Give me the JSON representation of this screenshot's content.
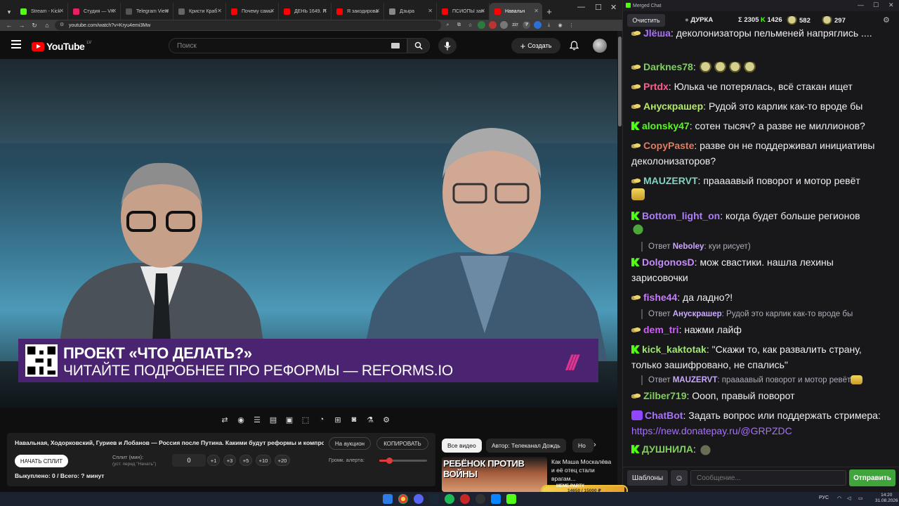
{
  "browser": {
    "tabs": [
      {
        "label": "Stream - Kick",
        "color": "#53fc18"
      },
      {
        "label": "Студия — VK",
        "color": "#e91e63"
      },
      {
        "label": "Telegram View",
        "color": "#555555"
      },
      {
        "label": "Кристи Краб",
        "color": "#666666"
      },
      {
        "label": "Почему самы",
        "color": "#ff0000"
      },
      {
        "label": "ДЕНЬ 1649. П",
        "color": "#ff0000"
      },
      {
        "label": "Я закодирова",
        "color": "#ff0000"
      },
      {
        "label": "Дзыра",
        "color": "#888888"
      },
      {
        "label": "ПСИОПЫ зап",
        "color": "#ff0000"
      },
      {
        "label": "Навальн",
        "color": "#ff0000",
        "active": true
      }
    ],
    "url": "youtube.com/watch?v=Kryu4emi3Mw",
    "ext_badge": "237"
  },
  "youtube": {
    "logo": "YouTube",
    "country": "LV",
    "search_placeholder": "Поиск",
    "create_label": "Создать"
  },
  "video": {
    "banner_line1": "ПРОЕКТ «ЧТО ДЕЛАТЬ?»",
    "banner_line2": "ЧИТАЙТЕ ПОДРОБНЕЕ ПРО РЕФОРМЫ — REFORMS.IO",
    "banner_mark": "///"
  },
  "info": {
    "title": "Навальная, Ходорковский, Гуриев и Лобанов — Россия после Путина. Какими будут реформы и компро...",
    "auction_label": "На аукцион",
    "copy_label": "КОПИРОВАТЬ",
    "split_button": "НАЧАТЬ СПЛИТ",
    "split_label": "Сплит (мин):",
    "split_hint": "(уст. перед \"Начать\")",
    "split_value": "0",
    "steps": [
      "+1",
      "+3",
      "+5",
      "+10",
      "+20"
    ],
    "alert_label": "Громк. алерта:",
    "alert_volume": 0.2,
    "bought": "Выкуплено: 0 / Всего: ? минут"
  },
  "recs": {
    "chips": [
      "Все видео",
      "Автор: Телеканал Дождь",
      "Но"
    ],
    "thumb_text": "РЕБЁНОК ПРОТИВ ВОЙНЫ",
    "rec_title": "Как Маша Москалёва и её отец стали врагам..."
  },
  "stream_goal": {
    "label": "МЕМЕ-PARTY",
    "text": "14650 / 15000 ₽",
    "progress": 0.976
  },
  "taskbar": {
    "lang": "РУС",
    "time": "14:20",
    "date": "31.08.2026"
  },
  "chat": {
    "window_title": "Merged Chat",
    "clear_label": "Очистить",
    "stats": {
      "status": "ДУРКА",
      "sigma": "Σ 2305",
      "kick": "1426",
      "other": "582",
      "viewers": "297"
    },
    "messages": [
      {
        "badge": "sub",
        "nick": "Jlёша",
        "color": "#a970ff",
        "text": "деколонизаторы пельменей напряглись ...."
      },
      {
        "badge": "sub",
        "nick": "Darknes78",
        "color": "#7fcf5c",
        "text": "",
        "emotes": [
          "ape",
          "ape",
          "ape",
          "ape"
        ]
      },
      {
        "badge": "sub",
        "nick": "Prtdx",
        "color": "#ff5d8f",
        "text": "Юлька че потерялась, всё стакан ищет"
      },
      {
        "badge": "sub",
        "nick": "Анускрашер",
        "color": "#b3e86a",
        "text": "Рудой это карлик как-то вроде бы"
      },
      {
        "badge": "kick",
        "nick": "alonsky47",
        "color": "#53fc18",
        "text": "сотен тысяч? а разве не миллионов?"
      },
      {
        "badge": "sub",
        "nick": "CopyPaste",
        "color": "#e07a5f",
        "text": "разве он не поддерживал инициативы деколонизаторов?"
      },
      {
        "badge": "sub",
        "nick": "MAUZERVT",
        "color": "#7fd4c1",
        "text": "праааавый поворот и мотор ревёт",
        "emotes": [
          "cat"
        ]
      },
      {
        "badge": "kick",
        "nick": "Bottom_light_on",
        "color": "#b07cff",
        "text": "когда будет больше регионов",
        "emotes": [
          "pepe"
        ]
      },
      {
        "reply": true,
        "prefix": "Ответ",
        "nick": "Neboley",
        "text": "куи рисует)"
      },
      {
        "badge": "kick",
        "nick": "DolgonosD",
        "color": "#c58bff",
        "text": "мож свастики. нашла лехины зарисовочки"
      },
      {
        "badge": "sub",
        "nick": "fishe44",
        "color": "#c97bff",
        "text": "да ладно?!"
      },
      {
        "reply": true,
        "prefix": "Ответ",
        "nick": "Анускрашер",
        "text": "Рудой это карлик как-то вроде бы"
      },
      {
        "badge": "sub",
        "nick": "dem_tri",
        "color": "#d35cff",
        "text": "нажми лайф"
      },
      {
        "badge": "kick",
        "nick": "kick_kaktotak",
        "color": "#9fe870",
        "text": "\"Скажи то, как развалить страну, только зашифровано, не спались\""
      },
      {
        "reply": true,
        "prefix": "Ответ",
        "nick": "MAUZERVT",
        "text": "праааавый поворот и мотор ревёт"
      },
      {
        "badge": "sub",
        "nick": "Zilber719",
        "color": "#7fcf5c",
        "text": "Оооп, правый поворот"
      },
      {
        "badge": "bot",
        "nick": "ChatBot",
        "color": "#a970ff",
        "text": "Задать вопрос или поддержать стримера: ",
        "link": "https://new.donatepay.ru/@GRPZDC"
      },
      {
        "badge": "kick",
        "nick": "ДУШНИЛА",
        "color": "#7fcf5c",
        "text": "",
        "emotes": [
          "grim"
        ]
      }
    ],
    "templates_label": "Шаблоны",
    "input_placeholder": "Сообщение...",
    "send_label": "Отправить"
  }
}
